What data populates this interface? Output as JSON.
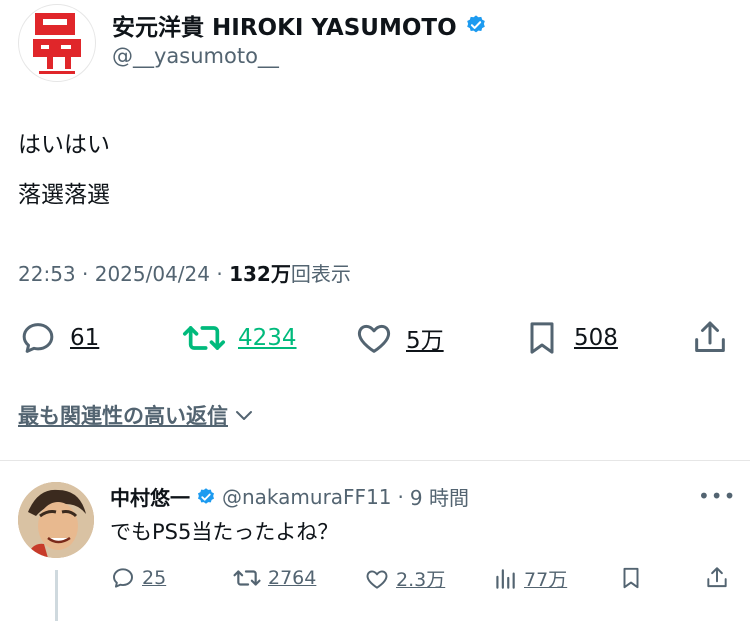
{
  "tweet": {
    "author_name": "安元洋貴 HIROKI YASUMOTO",
    "author_handle": "@__yasumoto__",
    "text_line1": "はいはい",
    "text_line2": "落選落選",
    "time": "22:53",
    "separator": "·",
    "date": "2025/04/24",
    "views_count": "132万",
    "views_label": "回表示",
    "replies": "61",
    "retweets": "4234",
    "likes": "5万",
    "bookmarks": "508"
  },
  "sort_label": "最も関連性の高い返信",
  "reply": {
    "author_name": "中村悠一",
    "author_handle": "@nakamuraFF11",
    "separator": "·",
    "time": "9 時間",
    "more": "•••",
    "text": "でもPS5当たったよね？",
    "replies": "25",
    "retweets": "2764",
    "likes": "2.3万",
    "views": "77万"
  },
  "colors": {
    "verified": "#1d9bf0",
    "retweet_active": "#00ba7c",
    "secondary_text": "#536471",
    "avatar_red": "#e0262a"
  },
  "icons": [
    "verified-badge-icon",
    "reply-icon",
    "retweet-icon",
    "like-icon",
    "bookmark-icon",
    "share-icon",
    "chevron-down-icon",
    "views-icon",
    "more-icon"
  ]
}
